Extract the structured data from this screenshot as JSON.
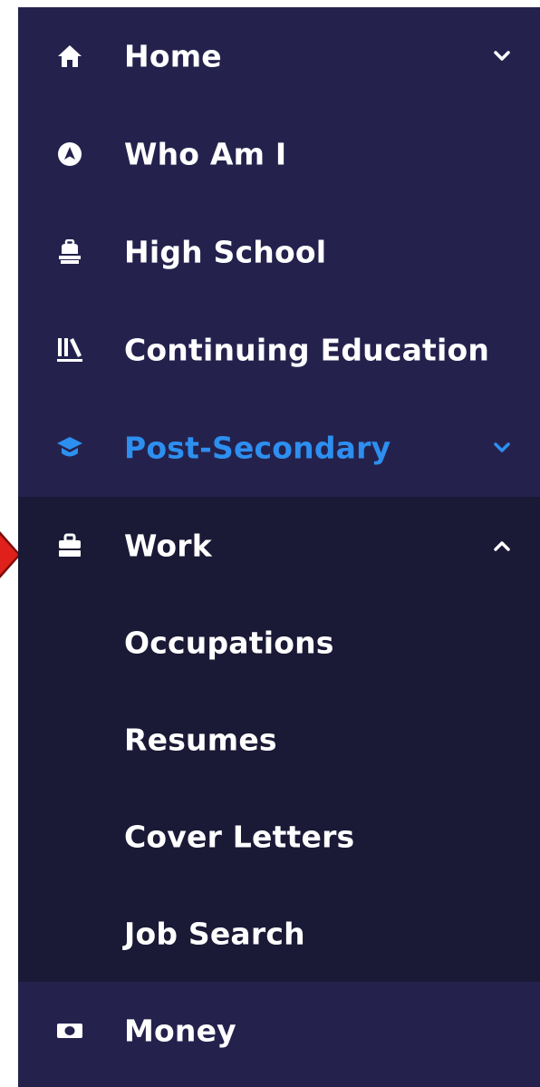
{
  "nav": {
    "items": [
      {
        "label": "Home",
        "icon": "home-icon",
        "chevron": "down"
      },
      {
        "label": "Who Am I",
        "icon": "compass-icon"
      },
      {
        "label": "High School",
        "icon": "backpack-icon"
      },
      {
        "label": "Continuing Education",
        "icon": "library-icon"
      },
      {
        "label": "Post-Secondary",
        "icon": "graduation-cap-icon",
        "chevron": "down",
        "active": true
      },
      {
        "label": "Work",
        "icon": "briefcase-icon",
        "chevron": "up",
        "expanded": true
      },
      {
        "label": "Money",
        "icon": "money-icon"
      }
    ],
    "work_submenu": [
      {
        "label": "Occupations"
      },
      {
        "label": "Resumes"
      },
      {
        "label": "Cover Letters"
      },
      {
        "label": "Job Search"
      }
    ]
  },
  "colors": {
    "sidebar_bg": "#24224d",
    "submenu_bg": "#1a1936",
    "text": "#ffffff",
    "active": "#2d8ff0",
    "marker": "#e0201a"
  }
}
